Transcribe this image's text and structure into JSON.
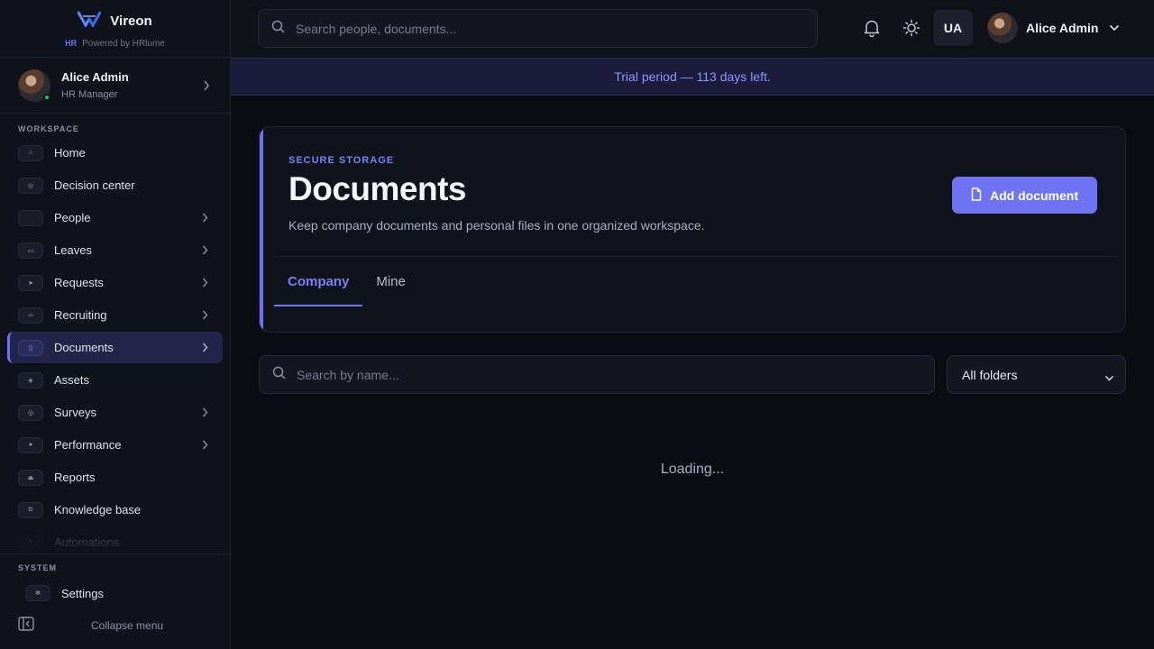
{
  "brand": {
    "name": "Vireon",
    "powered_badge": "HR",
    "powered_by": "Powered by HRlume"
  },
  "sidebar": {
    "user": {
      "name": "Alice Admin",
      "role": "HR Manager"
    },
    "workspace_label": "WORKSPACE",
    "items": [
      {
        "label": "Home",
        "icon": "home-icon",
        "has_submenu": false
      },
      {
        "label": "Decision center",
        "icon": "decision-icon",
        "has_submenu": false
      },
      {
        "label": "People",
        "icon": "people-icon",
        "has_submenu": true
      },
      {
        "label": "Leaves",
        "icon": "calendar-icon",
        "has_submenu": true
      },
      {
        "label": "Requests",
        "icon": "send-icon",
        "has_submenu": true
      },
      {
        "label": "Recruiting",
        "icon": "briefcase-icon",
        "has_submenu": true
      },
      {
        "label": "Documents",
        "icon": "document-icon",
        "has_submenu": true,
        "active": true
      },
      {
        "label": "Assets",
        "icon": "asset-icon",
        "has_submenu": false
      },
      {
        "label": "Surveys",
        "icon": "survey-icon",
        "has_submenu": true
      },
      {
        "label": "Performance",
        "icon": "target-icon",
        "has_submenu": true
      },
      {
        "label": "Reports",
        "icon": "chart-icon",
        "has_submenu": false
      },
      {
        "label": "Knowledge base",
        "icon": "book-icon",
        "has_submenu": false
      },
      {
        "label": "Automations",
        "icon": "bolt-icon",
        "has_submenu": false
      }
    ],
    "system_label": "SYSTEM",
    "settings_label": "Settings",
    "collapse_label": "Collapse menu"
  },
  "topbar": {
    "search_placeholder": "Search people, documents...",
    "language": "UA",
    "user_name": "Alice Admin"
  },
  "trial_banner": "Trial period — 113 days left.",
  "documents": {
    "eyebrow": "SECURE STORAGE",
    "title": "Documents",
    "subtitle": "Keep company documents and personal files in one organized workspace.",
    "add_button": "Add document",
    "tabs": [
      {
        "label": "Company",
        "active": true
      },
      {
        "label": "Mine",
        "active": false
      }
    ],
    "search_placeholder": "Search by name...",
    "folder_filter": "All folders",
    "loading_text": "Loading..."
  },
  "colors": {
    "accent": "#6e73f2",
    "background": "#0b0c12",
    "sidebar": "#10121b",
    "online": "#22c55e"
  }
}
